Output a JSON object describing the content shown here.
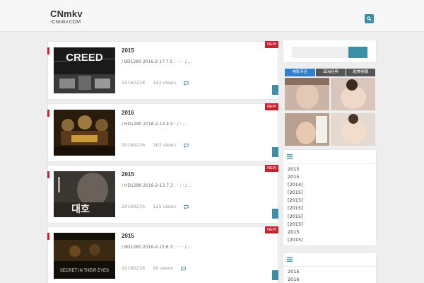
{
  "header": {
    "site_title": "CNmkv",
    "site_description": "-CNmkv.COM",
    "search_icon": "search-icon"
  },
  "posts": [
    {
      "title": "2015",
      "excerpt": "/ BD1280 2016-2-17 7.5 : · : · / ...",
      "date": "20160218",
      "views": "192 views",
      "badge": "NEW",
      "thumb_text": "CREED"
    },
    {
      "title": "2016",
      "excerpt": "/ HD1280 2016-2-14 4.5 : / : ...",
      "date": "20160216",
      "views": "183 views",
      "badge": "NEW",
      "thumb_text": ""
    },
    {
      "title": "2015",
      "excerpt": "/ HD1280 2016-2-13 7.3 : · : · / ...",
      "date": "20160216",
      "views": "125 views",
      "badge": "NEW",
      "thumb_text": "대호"
    },
    {
      "title": "2015",
      "excerpt": "/ BD1280 2016-2-15 6.3 : · : · / ...",
      "date": "20160216",
      "views": "90 views",
      "badge": "NEW",
      "thumb_text": "SECRET IN THEIR EYES"
    }
  ],
  "sidebar": {
    "tabs": [
      "电影专区",
      "亚洲经典",
      "欧美制服"
    ],
    "widget1": {
      "icon": "menu-icon",
      "items": [
        "2015",
        "2015",
        "[2014]",
        "[2015]",
        "[2015]",
        "[2015]",
        "[2015]",
        "[2015]",
        "2015",
        "[2015]"
      ]
    },
    "widget2": {
      "icon": "menu-icon",
      "items": [
        "2015",
        "2016"
      ]
    }
  },
  "colors": {
    "accent": "#3b8ea5",
    "badge": "#c8202f",
    "tab_active": "#2f7fcc"
  }
}
